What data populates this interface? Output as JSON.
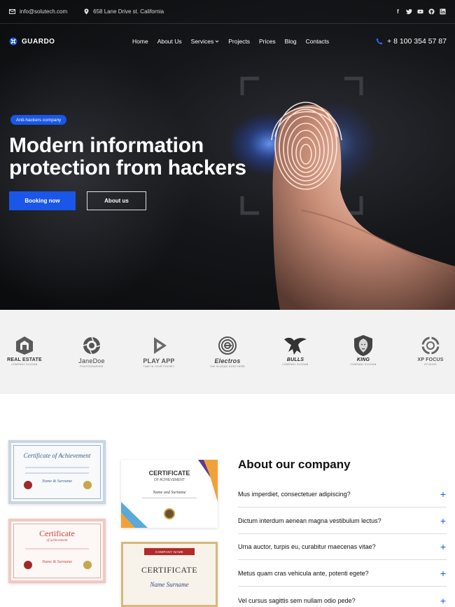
{
  "topbar": {
    "email": "info@solutech.com",
    "address": "658 Lane Drive st. California",
    "socials": [
      "facebook-icon",
      "twitter-icon",
      "youtube-icon",
      "github-icon",
      "linkedin-icon"
    ]
  },
  "brand": {
    "name": "GUARDO",
    "accent": "#1a56e8"
  },
  "nav": {
    "items": [
      {
        "label": "Home"
      },
      {
        "label": "About Us"
      },
      {
        "label": "Services",
        "dropdown": true
      },
      {
        "label": "Projects"
      },
      {
        "label": "Prices"
      },
      {
        "label": "Blog"
      },
      {
        "label": "Contacts"
      }
    ],
    "phone": "+ 8 100 354 57 87"
  },
  "hero": {
    "badge": "Anti-hackers company",
    "title": "Modern information protection from hackers",
    "primary_button": "Booking now",
    "secondary_button": "About us"
  },
  "partners": [
    {
      "name": "REAL ESTATE",
      "sub": "COMPANY SLOGAN"
    },
    {
      "name": "JaneDoe",
      "sub": "PHOTOGRAPHER"
    },
    {
      "name": "PLAY APP",
      "sub": "TIME IN YOUR POCKET"
    },
    {
      "name": "Electros",
      "sub": "THE SLOGAN GOES HERE"
    },
    {
      "name": "BULLS",
      "sub": "COMPANY SLOGAN"
    },
    {
      "name": "KING",
      "sub": "COMPANY SLOGAN"
    },
    {
      "name": "XP FOCUS",
      "sub": "STUDIOS"
    }
  ],
  "certificates": [
    {
      "title": "Certificate of Achievement",
      "name": "Name & Surname"
    },
    {
      "title": "Certificate",
      "subtitle": "of achievement",
      "name": "Name & Surname"
    },
    {
      "title": "CERTIFICATE",
      "subtitle": "OF ACHIEVEMENT",
      "name": "Name and Surname"
    },
    {
      "ribbon": "COMPANY NAME",
      "title": "CERTIFICATE",
      "name": "Name Surname"
    }
  ],
  "about": {
    "title": "About our company",
    "faqs": [
      {
        "question": "Mus imperdiet, consectetuer adipiscing?"
      },
      {
        "question": "Dictum interdum aenean magna vestibulum lectus?"
      },
      {
        "question": "Urna auctor, turpis eu, curabitur maecenas vitae?"
      },
      {
        "question": "Metus quam cras vehicula ante, potenti egete?"
      },
      {
        "question": "Vel cursus sagittis sem nullam odio pede?"
      }
    ]
  }
}
